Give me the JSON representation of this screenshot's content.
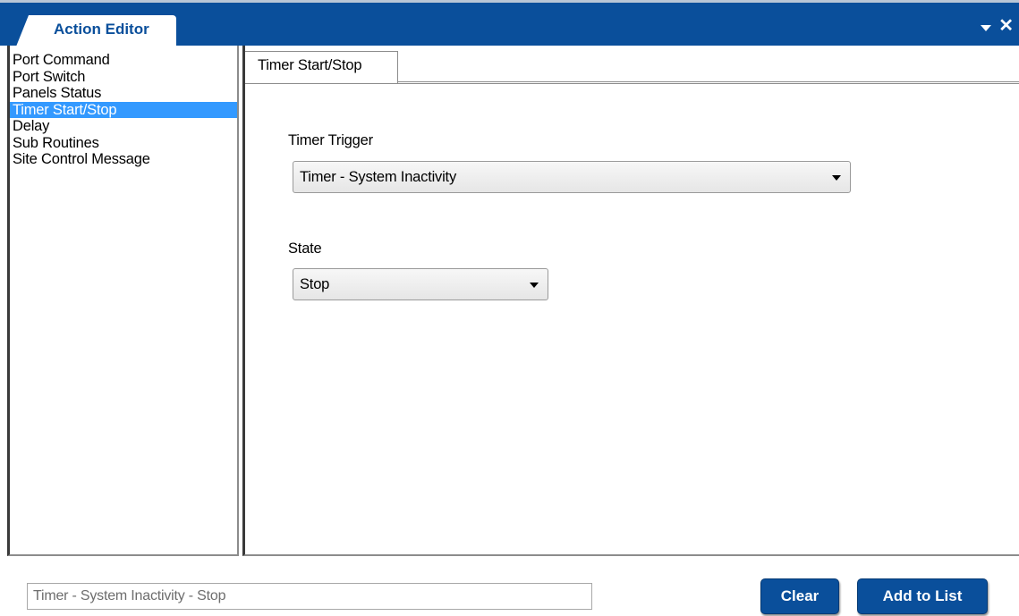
{
  "window": {
    "title": "Action Editor"
  },
  "action_list": {
    "items": [
      {
        "label": "Port Command"
      },
      {
        "label": "Port Switch"
      },
      {
        "label": "Panels Status"
      },
      {
        "label": "Timer Start/Stop",
        "selected": true
      },
      {
        "label": "Delay"
      },
      {
        "label": "Sub Routines"
      },
      {
        "label": "Site Control Message"
      }
    ]
  },
  "editor": {
    "tab_label": "Timer Start/Stop",
    "timer_trigger": {
      "label": "Timer Trigger",
      "value": "Timer - System Inactivity"
    },
    "state": {
      "label": "State",
      "value": "Stop"
    }
  },
  "footer": {
    "summary_value": "Timer - System Inactivity - Stop",
    "clear_label": "Clear",
    "add_label": "Add to List"
  },
  "colors": {
    "accent": "#0a4f9b",
    "selection": "#3399ff"
  },
  "icons": {
    "window_menu": "chevron-down-icon",
    "window_close": "close-icon",
    "select_arrow": "chevron-down-icon"
  }
}
